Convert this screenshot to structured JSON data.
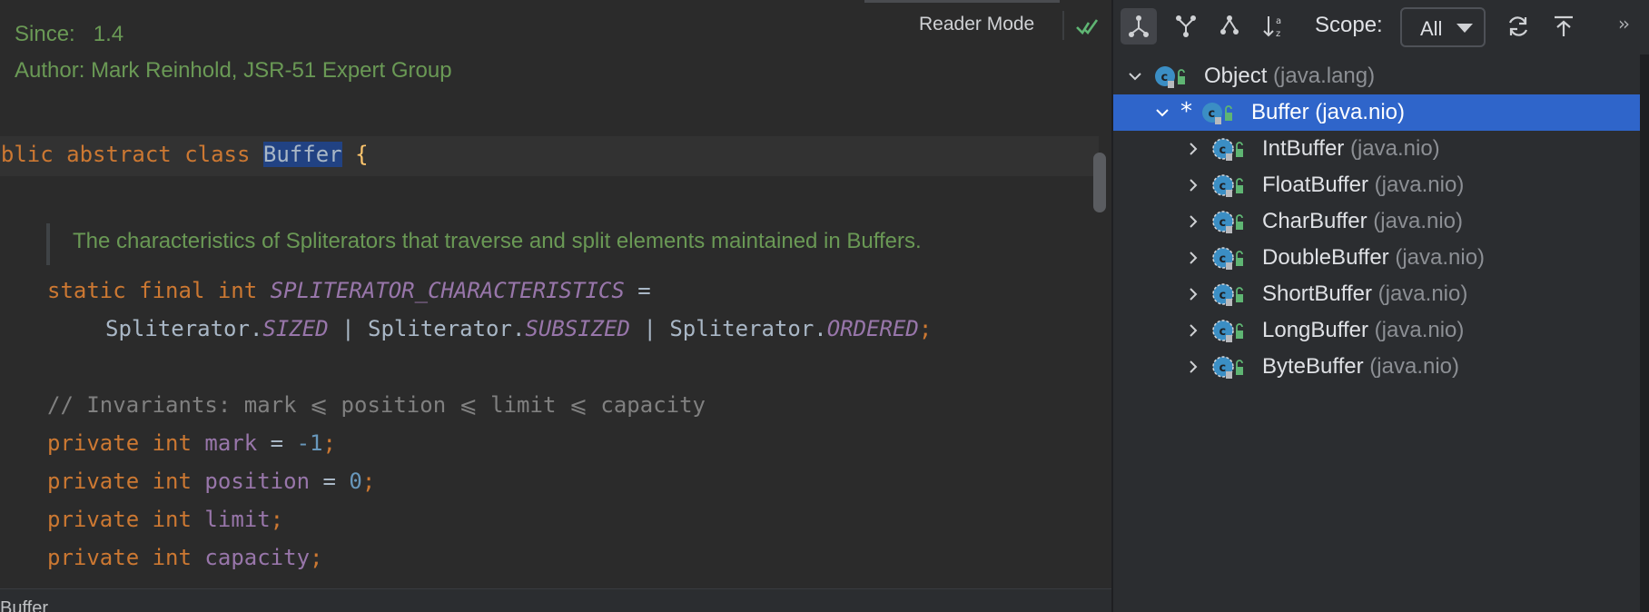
{
  "editor": {
    "reader_mode": "Reader Mode",
    "doc": {
      "since_label": "Since:",
      "since_value": "1.4",
      "author_label": "Author:",
      "author_value": "Mark Reinhold, JSR-51 Expert Group",
      "inline_comment": "The characteristics of Spliterators that traverse and split elements maintained in Buffers."
    },
    "code": {
      "decl_kw1": "public",
      "decl_kw2": "abstract",
      "decl_kw3": "class",
      "decl_name": "Buffer",
      "decl_brace": "{",
      "static": "static",
      "final": "final",
      "int": "int",
      "const_name": "SPLITERATOR_CHARACTERISTICS",
      "eq": "=",
      "spliterator": "Spliterator.",
      "sized": "SIZED",
      "pipe": "|",
      "subsized": "SUBSIZED",
      "ordered": "ORDERED",
      "semicolon": ";",
      "comment": "// Invariants: mark ⩽ position ⩽ limit ⩽ capacity",
      "private": "private",
      "mark": "mark",
      "minus_one": "-1",
      "position": "position",
      "zero": "0",
      "limit": "limit",
      "capacity": "capacity"
    },
    "status": "Buffer"
  },
  "hierarchy": {
    "toolbar": {
      "icons": [
        "supertypes-icon",
        "subtypes-icon",
        "class-hierarchy-icon",
        "sort-alpha-icon"
      ],
      "scope_label": "Scope:",
      "scope_value": "All",
      "refresh_icon": "refresh-icon",
      "export_icon": "export-icon",
      "more": "››"
    },
    "tree": [
      {
        "name": "Object",
        "pkg": "(java.lang)",
        "expanded": true,
        "selected": false,
        "base": false
      },
      {
        "name": "Buffer",
        "pkg": "(java.nio)",
        "expanded": true,
        "selected": true,
        "base": true,
        "marker": "*"
      },
      {
        "name": "IntBuffer",
        "pkg": "(java.nio)",
        "expanded": false,
        "selected": false,
        "base": false
      },
      {
        "name": "FloatBuffer",
        "pkg": "(java.nio)",
        "expanded": false,
        "selected": false,
        "base": false
      },
      {
        "name": "CharBuffer",
        "pkg": "(java.nio)",
        "expanded": false,
        "selected": false,
        "base": false
      },
      {
        "name": "DoubleBuffer",
        "pkg": "(java.nio)",
        "expanded": false,
        "selected": false,
        "base": false
      },
      {
        "name": "ShortBuffer",
        "pkg": "(java.nio)",
        "expanded": false,
        "selected": false,
        "base": false
      },
      {
        "name": "LongBuffer",
        "pkg": "(java.nio)",
        "expanded": false,
        "selected": false,
        "base": false
      },
      {
        "name": "ByteBuffer",
        "pkg": "(java.nio)",
        "expanded": false,
        "selected": false,
        "base": false
      }
    ]
  },
  "colors": {
    "keyword": "#cc7832",
    "doc_comment": "#6a9955",
    "selection": "#2f65ca",
    "class_icon": "#3b8ec4"
  }
}
